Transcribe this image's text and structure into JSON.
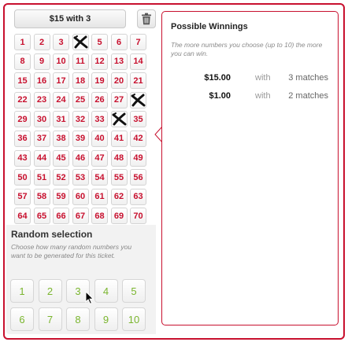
{
  "bet": {
    "label": "$15 with 3"
  },
  "numbers": [
    "1",
    "2",
    "3",
    "4",
    "5",
    "6",
    "7",
    "8",
    "9",
    "10",
    "11",
    "12",
    "13",
    "14",
    "15",
    "16",
    "17",
    "18",
    "19",
    "20",
    "21",
    "22",
    "23",
    "24",
    "25",
    "26",
    "27",
    "28",
    "29",
    "30",
    "31",
    "32",
    "33",
    "34",
    "35",
    "36",
    "37",
    "38",
    "39",
    "40",
    "41",
    "42",
    "43",
    "44",
    "45",
    "46",
    "47",
    "48",
    "49",
    "50",
    "51",
    "52",
    "53",
    "54",
    "55",
    "56",
    "57",
    "58",
    "59",
    "60",
    "61",
    "62",
    "63",
    "64",
    "65",
    "66",
    "67",
    "68",
    "69",
    "70"
  ],
  "picked": [
    "4",
    "28",
    "34"
  ],
  "random": {
    "title": "Random selection",
    "description": "Choose how many random numbers you want to be generated for this ticket.",
    "options": [
      "1",
      "2",
      "3",
      "4",
      "5",
      "6",
      "7",
      "8",
      "9",
      "10"
    ]
  },
  "winnings": {
    "title": "Possible Winnings",
    "description": "The more numbers you choose (up to 10) the more you can win.",
    "rows": [
      {
        "amount": "$15.00",
        "with": "with",
        "matches": "3 matches"
      },
      {
        "amount": "$1.00",
        "with": "with",
        "matches": "2 matches"
      }
    ]
  },
  "colors": {
    "accent": "#c8102e",
    "random_number": "#7ab52e",
    "mark": "#111111"
  },
  "icons": {
    "trash": "trash-icon",
    "pick_mark": "x-mark-icon",
    "cursor": "mouse-pointer-icon"
  }
}
